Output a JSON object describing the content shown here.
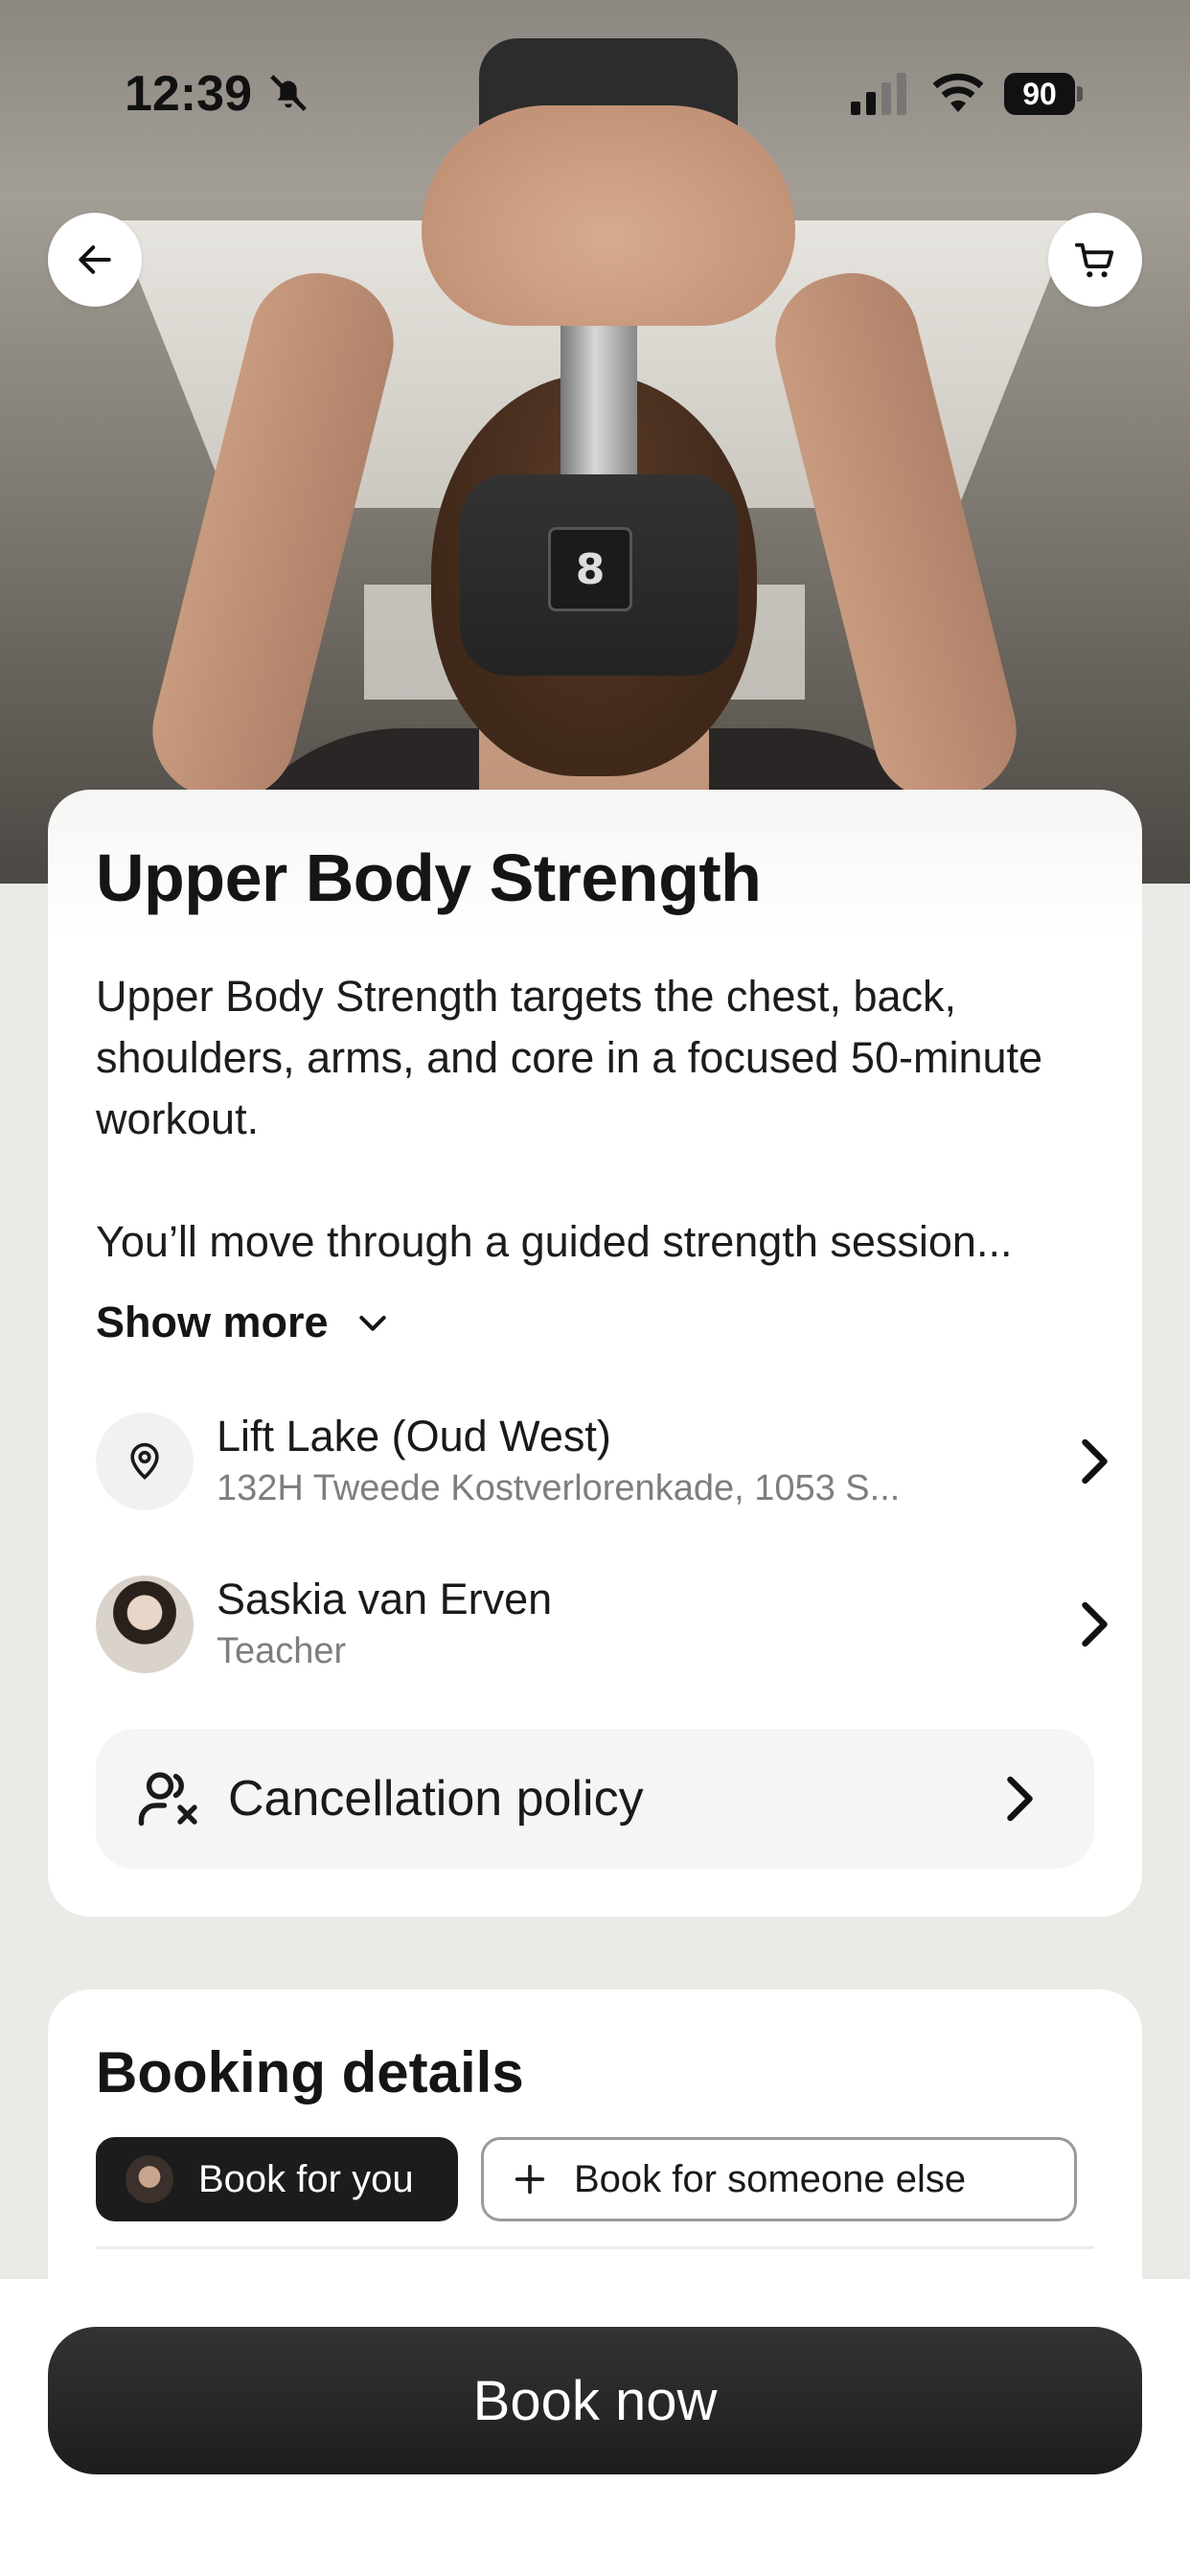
{
  "status_bar": {
    "time": "12:39",
    "battery": "90"
  },
  "hero": {
    "dumbbell_weight": "8"
  },
  "class": {
    "title": "Upper Body Strength",
    "description": "Upper Body Strength targets the chest, back, shoulders, arms, and core in a focused 50-minute workout.",
    "description_more": "You’ll move through a guided strength session...",
    "show_more_label": "Show more"
  },
  "location": {
    "name": "Lift Lake (Oud West)",
    "address": "132H Tweede Kostverlorenkade, 1053 S..."
  },
  "teacher": {
    "name": "Saskia van Erven",
    "role": "Teacher"
  },
  "cancellation": {
    "label": "Cancellation policy"
  },
  "booking": {
    "title": "Booking details",
    "for_you_label": "Book for you",
    "for_someone_else_label": "Book for someone else"
  },
  "cta": {
    "book_now_label": "Book now"
  },
  "colors": {
    "primary_dark": "#1c1c1c",
    "background": "#eaeae7",
    "card": "#ffffff",
    "muted_text": "#7e7e7e"
  },
  "icons": {
    "back": "arrow-left-icon",
    "cart": "cart-icon",
    "location": "map-pin-icon",
    "cancellation": "user-x-icon",
    "chevron": "chevron-right-icon",
    "show_more": "chevron-down-icon",
    "plus": "plus-icon"
  }
}
